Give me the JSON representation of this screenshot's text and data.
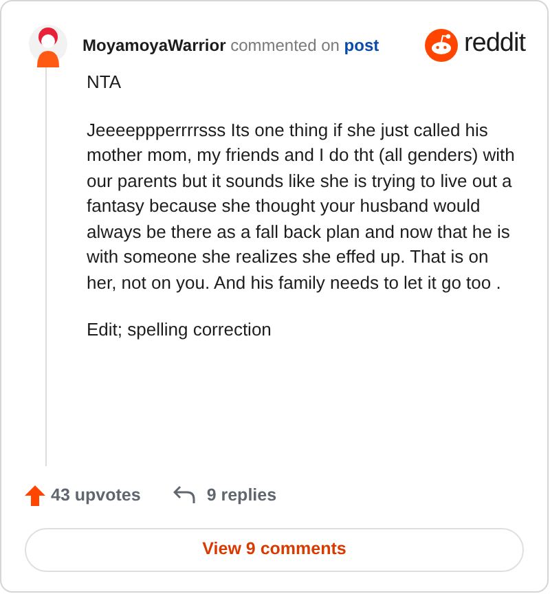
{
  "header": {
    "author": "MoyamoyaWarrior",
    "action": "commented on",
    "link": "post",
    "brand": "reddit"
  },
  "body": [
    "NTA",
    "Jeeeeppperrrrsss Its one thing if she just called his mother mom, my friends and I do tht (all genders) with our parents but it sounds like she is trying to live out a fantasy because she thought your husband would always be there as a fall back plan and now that he is with someone she realizes she effed up. That is on her, not on you. And his family needs to let it go too .",
    "Edit; spelling correction"
  ],
  "footer": {
    "upvotes": "43 upvotes",
    "replies": "9 replies",
    "button": "View 9 comments"
  }
}
